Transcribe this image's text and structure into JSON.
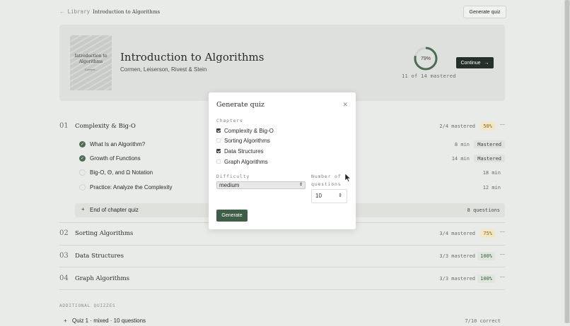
{
  "breadcrumb": {
    "root": "Library",
    "current": "Introduction to Algorithms"
  },
  "header": {
    "generate_quiz": "Generate quiz"
  },
  "book": {
    "cover_title": "Introduction to Algorithms",
    "cover_author": "Cormen...",
    "title": "Introduction to Algorithms",
    "authors": "Cormen, Leiserson, Rivest & Stein",
    "progress_label": "79%",
    "progress_value": 0.79,
    "mastered_summary": "11 of 14 mastered",
    "continue_label": "Continue"
  },
  "chapters": [
    {
      "num": "01",
      "name": "Complexity & Big-O",
      "status": "2/4 mastered",
      "pct": "50%",
      "lessons": [
        {
          "name": "What Is an Algorithm?",
          "duration": "8 min",
          "badge": "Mastered"
        },
        {
          "name": "Growth of Functions",
          "duration": "14 min",
          "badge": "Mastered"
        },
        {
          "name": "Big-O, Θ, and Ω Notation",
          "duration": "18 min"
        },
        {
          "name": "Practice: Analyze the Complexity",
          "duration": "12 min"
        }
      ],
      "end_quiz": {
        "label": "End of chapter quiz",
        "questions": "8 questions"
      }
    },
    {
      "num": "02",
      "name": "Sorting Algorithms",
      "status": "3/4 mastered",
      "pct": "75%"
    },
    {
      "num": "03",
      "name": "Data Structures",
      "status": "3/3 mastered",
      "pct": "100%"
    },
    {
      "num": "04",
      "name": "Graph Algorithms",
      "status": "3/3 mastered",
      "pct": "100%"
    }
  ],
  "additional": {
    "heading": "ADDITIONAL QUIZZES",
    "quizzes": [
      {
        "label": "Quiz 1 · mixed · 10 questions",
        "status": "7/10 correct"
      }
    ]
  },
  "modal": {
    "title": "Generate quiz",
    "chapters_label": "Chapters",
    "chapter_options": [
      {
        "label": "Complexity & Big-O",
        "checked": true
      },
      {
        "label": "Sorting Algorithms",
        "checked": false
      },
      {
        "label": "Data Structures",
        "checked": true
      },
      {
        "label": "Graph Algorithms",
        "checked": false
      }
    ],
    "difficulty_label": "Difficulty",
    "difficulty_value": "medium",
    "num_questions_label_1": "Number of",
    "num_questions_label_2": "questions",
    "num_questions_value": "10",
    "generate_label": "Generate"
  },
  "colors": {
    "accent": "#3f5e48",
    "pct_partial_bg": "#f3e7c7",
    "pct_full_bg": "#dfe7dc",
    "progress_ring": "#4d6b55"
  }
}
